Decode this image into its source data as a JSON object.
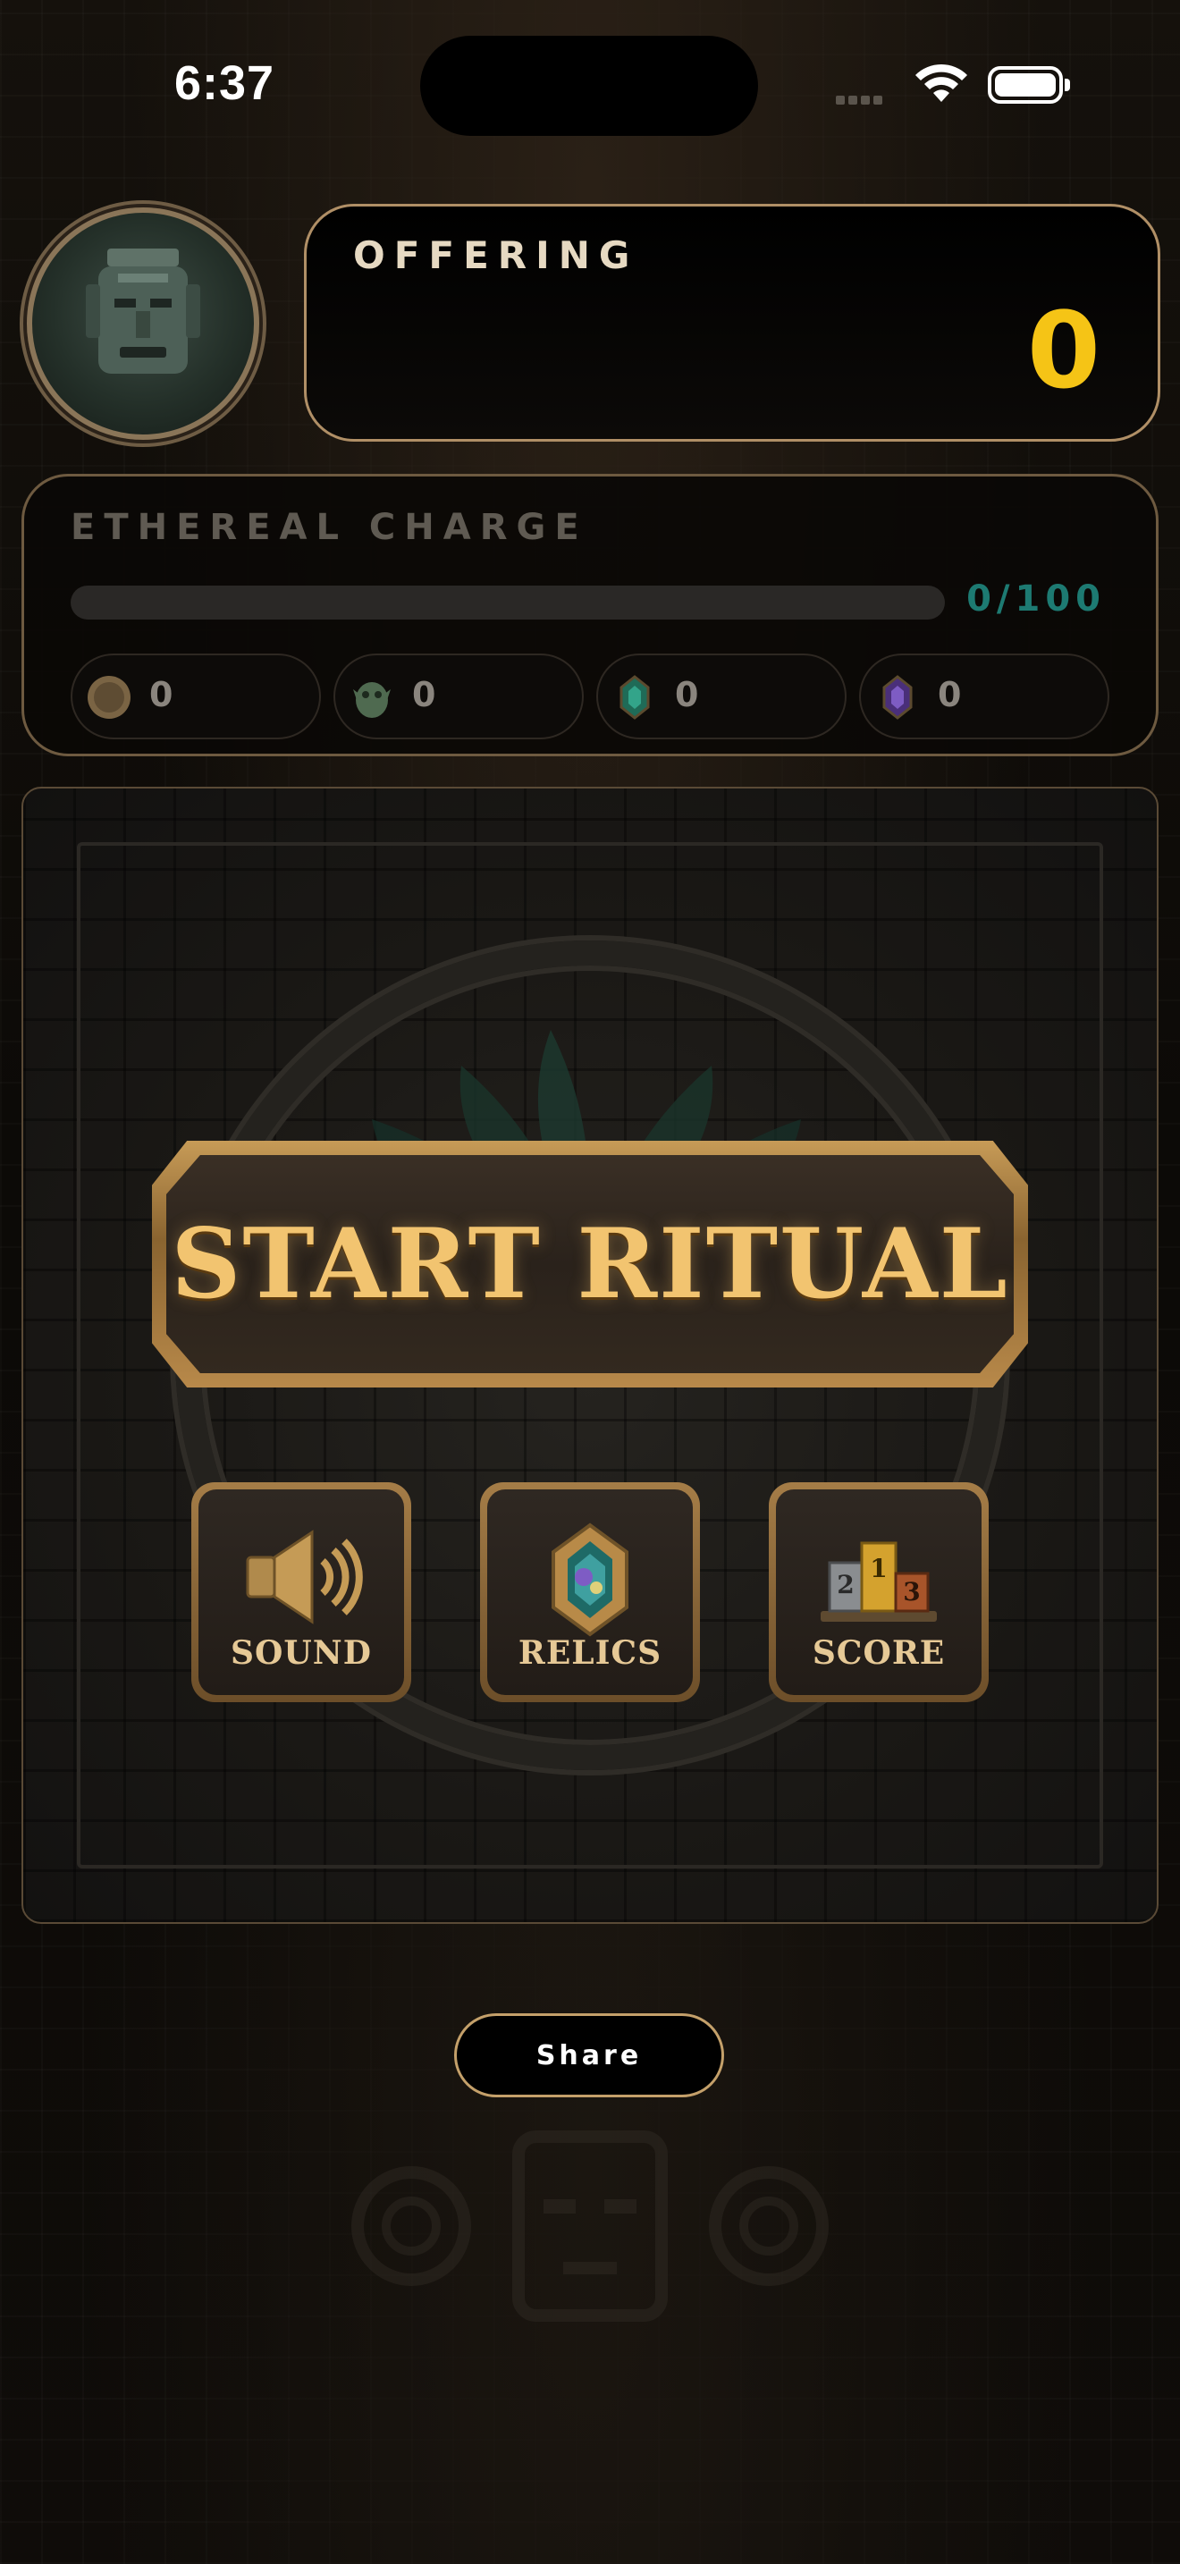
{
  "status_bar": {
    "time": "6:37"
  },
  "offering": {
    "label": "OFFERING",
    "value": "0"
  },
  "ethereal_charge": {
    "label": "ETHEREAL CHARGE",
    "progress_text": "0/100",
    "progress_fraction": 0,
    "relics": [
      {
        "icon": "coin-icon",
        "count": "0"
      },
      {
        "icon": "goblin-idol-icon",
        "count": "0"
      },
      {
        "icon": "emerald-gem-icon",
        "count": "0"
      },
      {
        "icon": "amethyst-gem-icon",
        "count": "0"
      }
    ]
  },
  "main": {
    "start_label": "START RITUAL",
    "buttons": [
      {
        "label": "SOUND",
        "icon": "speaker-icon"
      },
      {
        "label": "RELICS",
        "icon": "relic-gem-icon"
      },
      {
        "label": "SCORE",
        "icon": "podium-icon"
      }
    ]
  },
  "share_label": "Share",
  "colors": {
    "accent_gold": "#f5c416",
    "teal": "#1d7a72",
    "bronze": "#b08f66"
  }
}
